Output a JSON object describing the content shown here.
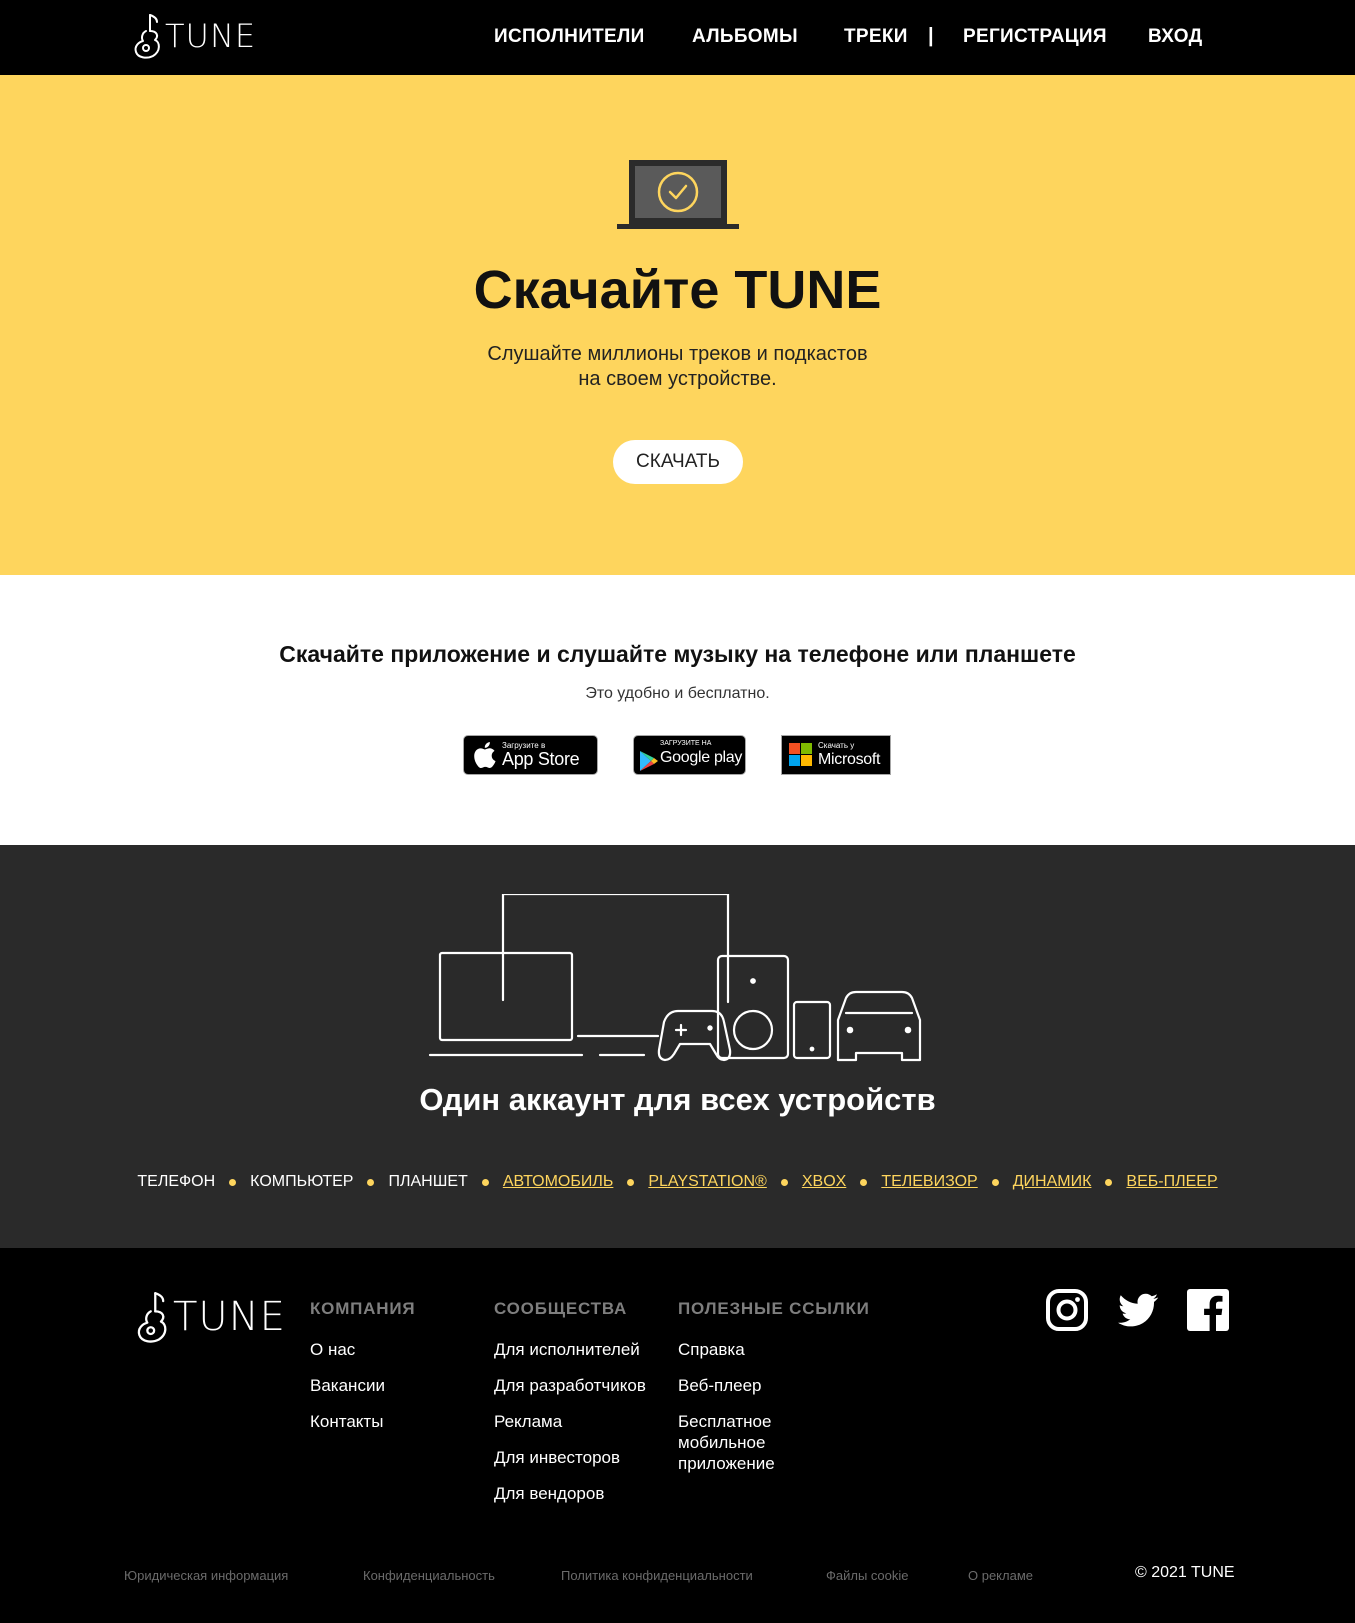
{
  "header": {
    "logo_text": "TUNE",
    "nav": [
      "ИСПОЛНИТЕЛИ",
      "АЛЬБОМЫ",
      "ТРЕКИ"
    ],
    "separator": "|",
    "auth": [
      "РЕГИСТРАЦИЯ",
      "ВХОД"
    ]
  },
  "hero": {
    "title": "Скачайте TUNE",
    "subtitle_line1": "Слушайте миллионы треков и подкастов",
    "subtitle_line2": "на своем устройстве.",
    "button": "СКАЧАТЬ",
    "icon": "laptop-check-icon"
  },
  "apps": {
    "title": "Скачайте приложение и слушайте музыку на телефоне или планшете",
    "subtitle": "Это удобно и бесплатно.",
    "app_store": {
      "small": "Загрузите в",
      "big": "App Store"
    },
    "google_play": {
      "small": "ЗАГРУЗИТЕ НА",
      "big": "Google play"
    },
    "microsoft": {
      "small": "Скачать у",
      "big": "Microsoft"
    }
  },
  "devices": {
    "title": "Один аккаунт для всех устройств",
    "items": [
      {
        "label": "ТЕЛЕФОН",
        "link": false
      },
      {
        "label": "КОМПЬЮТЕР",
        "link": false
      },
      {
        "label": "ПЛАНШЕТ",
        "link": false
      },
      {
        "label": "АВТОМОБИЛЬ",
        "link": true
      },
      {
        "label": "PLAYSTATION®",
        "link": true
      },
      {
        "label": "XBOX",
        "link": true
      },
      {
        "label": "ТЕЛЕВИЗОР",
        "link": true
      },
      {
        "label": "ДИНАМИК",
        "link": true
      },
      {
        "label": "ВЕБ-ПЛЕЕР",
        "link": true
      }
    ]
  },
  "footer": {
    "logo_text": "TUNE",
    "company": {
      "title": "КОМПАНИЯ",
      "links": [
        "О нас",
        "Вакансии",
        "Контакты"
      ]
    },
    "communities": {
      "title": "СООБЩЕСТВА",
      "links": [
        "Для исполнителей",
        "Для разработчиков",
        "Реклама",
        "Для инвесторов",
        "Для вендоров"
      ]
    },
    "useful": {
      "title": "ПОЛЕЗНЫЕ ССЫЛКИ",
      "links": [
        "Справка",
        "Веб-плеер",
        "Бесплатное мобильное приложение"
      ]
    },
    "social": [
      "instagram-icon",
      "twitter-icon",
      "facebook-icon"
    ],
    "legal": [
      "Юридическая информация",
      "Конфиденциальность",
      "Политика конфиденциальности",
      "Файлы cookie",
      "О рекламе"
    ],
    "copyright": "© 2021 TUNE"
  },
  "colors": {
    "accent": "#fed55d",
    "dark": "#2a2a2a",
    "black": "#000000"
  }
}
